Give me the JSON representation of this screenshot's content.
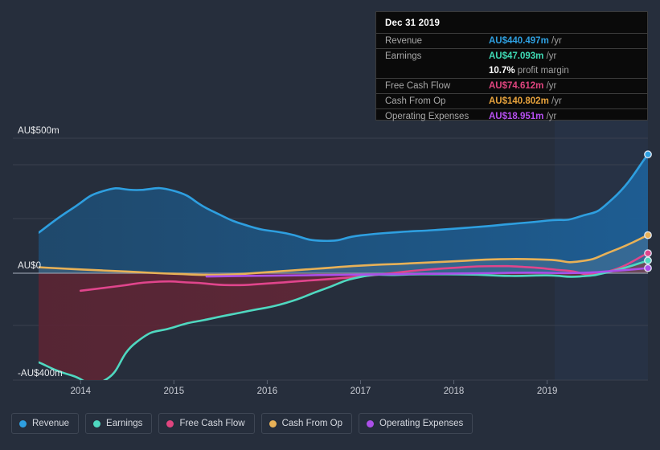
{
  "chart_data": {
    "type": "area",
    "title": "",
    "xlabel": "",
    "ylabel": "",
    "currency": "AU$",
    "grid": true,
    "legend_position": "bottom",
    "x_ticks": [
      "2014",
      "2015",
      "2016",
      "2017",
      "2018",
      "2019"
    ],
    "y_ticks": [
      "AU$500m",
      "AU$0",
      "-AU$400m"
    ],
    "y_tick_values": [
      500,
      0,
      -400
    ],
    "ylim": [
      -400,
      500
    ],
    "xlim": [
      2013.55,
      2020.08
    ],
    "units": "AU$ millions per year",
    "series": [
      {
        "name": "Revenue",
        "color": "#2e9fe0",
        "x": [
          2013.55,
          2013.9,
          2014.25,
          2014.6,
          2015.0,
          2015.4,
          2015.8,
          2016.2,
          2016.6,
          2017.0,
          2017.4,
          2017.8,
          2018.2,
          2018.6,
          2019.0,
          2019.35,
          2019.7,
          2020.08
        ],
        "values": [
          150,
          237,
          305,
          308,
          305,
          232,
          175,
          148,
          120,
          140,
          152,
          160,
          170,
          182,
          195,
          210,
          275,
          440
        ]
      },
      {
        "name": "Earnings",
        "color": "#4fd8c0",
        "x": [
          2013.55,
          2013.9,
          2014.25,
          2014.6,
          2015.0,
          2015.4,
          2015.8,
          2016.2,
          2016.6,
          2017.0,
          2017.4,
          2017.8,
          2018.2,
          2018.6,
          2019.0,
          2019.35,
          2019.7,
          2020.08
        ],
        "values": [
          -330,
          -378,
          -398,
          -255,
          -200,
          -168,
          -140,
          -110,
          -60,
          -14,
          -6,
          -4,
          -5,
          -10,
          -8,
          -12,
          8,
          47
        ]
      },
      {
        "name": "Free Cash Flow",
        "color": "#e0458c",
        "x": [
          2014.0,
          2014.4,
          2014.8,
          2015.2,
          2015.6,
          2016.0,
          2016.4,
          2016.8,
          2017.2,
          2017.6,
          2018.0,
          2018.4,
          2018.8,
          2019.2,
          2019.6,
          2020.08
        ],
        "values": [
          -65,
          -48,
          -32,
          -35,
          -44,
          -38,
          -28,
          -18,
          -5,
          10,
          20,
          26,
          22,
          10,
          2,
          74
        ]
      },
      {
        "name": "Cash From Op",
        "color": "#e8b157",
        "x": [
          2013.55,
          2014.0,
          2014.5,
          2015.0,
          2015.5,
          2016.0,
          2016.5,
          2017.0,
          2017.5,
          2018.0,
          2018.5,
          2019.0,
          2019.35,
          2019.7,
          2020.08
        ],
        "values": [
          22,
          14,
          6,
          -2,
          -6,
          4,
          16,
          28,
          36,
          44,
          52,
          50,
          44,
          82,
          141
        ]
      },
      {
        "name": "Operating Expenses",
        "color": "#ab4fe8",
        "x": [
          2015.35,
          2015.8,
          2016.3,
          2016.8,
          2017.3,
          2017.8,
          2018.3,
          2018.8,
          2019.3,
          2019.7,
          2020.08
        ],
        "values": [
          -12,
          -10,
          -8,
          -6,
          -4,
          -2,
          0,
          2,
          1,
          8,
          19
        ]
      }
    ]
  },
  "tooltip": {
    "title": "Dec 31 2019",
    "rows": [
      {
        "key": "Revenue",
        "value": "AU$440.497m",
        "unit": "/yr",
        "color": "#2e9fe0"
      },
      {
        "key": "Earnings",
        "value": "AU$47.093m",
        "unit": "/yr",
        "color": "#3fd9b4"
      },
      {
        "key": "",
        "value": "10.7%",
        "unit": "profit margin",
        "color": "#ffffff"
      },
      {
        "key": "Free Cash Flow",
        "value": "AU$74.612m",
        "unit": "/yr",
        "color": "#e0457f"
      },
      {
        "key": "Cash From Op",
        "value": "AU$140.802m",
        "unit": "/yr",
        "color": "#e8a33c"
      },
      {
        "key": "Operating Expenses",
        "value": "AU$18.951m",
        "unit": "/yr",
        "color": "#b64ff0"
      }
    ]
  },
  "legend": {
    "items": [
      {
        "label": "Revenue",
        "color": "#2e9fe0"
      },
      {
        "label": "Earnings",
        "color": "#4fd8c0"
      },
      {
        "label": "Free Cash Flow",
        "color": "#e0457f"
      },
      {
        "label": "Cash From Op",
        "color": "#e8b157"
      },
      {
        "label": "Operating Expenses",
        "color": "#ab4fe8"
      }
    ]
  },
  "axes": {
    "y_labels": [
      {
        "text": "AU$500m",
        "value": 500
      },
      {
        "text": "AU$0",
        "value": 0
      },
      {
        "text": "-AU$400m",
        "value": -400
      }
    ],
    "x_labels": [
      "2014",
      "2015",
      "2016",
      "2017",
      "2018",
      "2019"
    ]
  },
  "colors": {
    "background": "#262e3c",
    "grid": "#39404e",
    "zero_line": "#9aa2b0",
    "tooltip_bg": "#0a0a0a",
    "highlight_band": "#2b3850"
  }
}
